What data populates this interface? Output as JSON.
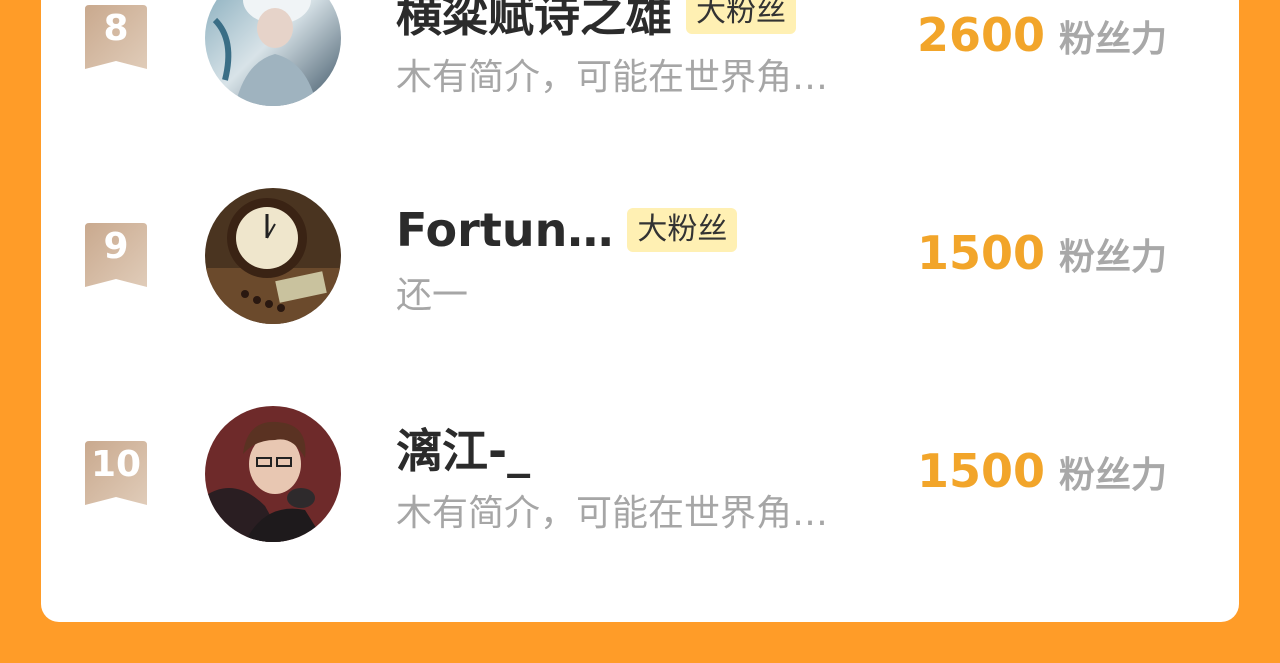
{
  "rows": [
    {
      "rank": "8",
      "name": "横粱赋诗之雄",
      "tag": "大粉丝",
      "intro": "木有简介，可能在世界角…",
      "score": "2600",
      "unit": "粉丝力"
    },
    {
      "rank": "9",
      "name": "Fortun…",
      "tag": "大粉丝",
      "intro": "还一",
      "score": "1500",
      "unit": "粉丝力"
    },
    {
      "rank": "10",
      "name": "漓江-_",
      "tag": "",
      "intro": "木有简介，可能在世界角…",
      "score": "1500",
      "unit": "粉丝力"
    }
  ],
  "colors": {
    "background": "#FF9C28",
    "score": "#F2A52A",
    "tag_bg": "#FFF0B3",
    "rank_badge": "#D3B69B"
  },
  "icons": [
    "bookmark-rank-badge"
  ]
}
